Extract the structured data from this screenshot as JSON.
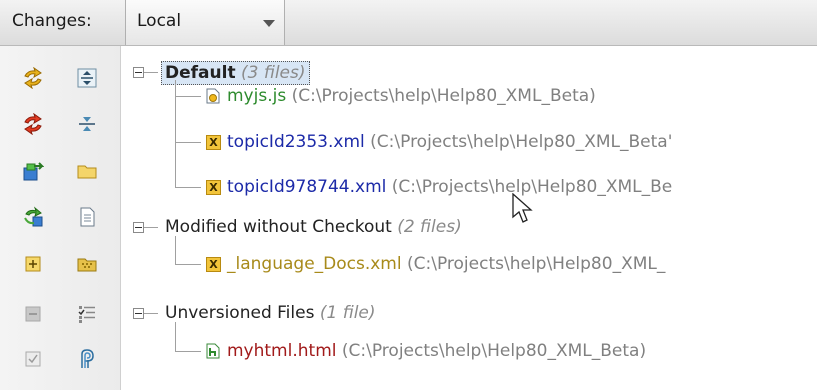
{
  "header": {
    "changes_label": "Changes:",
    "changelist_value": "Local"
  },
  "toolbar": {
    "icons": [
      "refresh-icon",
      "expand-all-icon",
      "rollback-icon",
      "collapse-all-icon",
      "move-to-changelist-icon",
      "folder-icon",
      "update-icon",
      "file-icon",
      "expand-icon",
      "package-icon",
      "disabled-icon",
      "diff-icon",
      "checkbox-icon",
      "history-icon"
    ]
  },
  "tree": {
    "groups": [
      {
        "name": "Default",
        "count": "(3 files)",
        "files": [
          {
            "name": "myjs.js",
            "path": "(C:\\Projects\\help\\Help80_XML_Beta)",
            "type": "js",
            "color": "#2e8b2e"
          },
          {
            "name": "topicId2353.xml",
            "path": "(C:\\Projects\\help\\Help80_XML_Beta'",
            "type": "xml",
            "color": "#1c2aa8"
          },
          {
            "name": "topicId978744.xml",
            "path": "(C:\\Projects\\help\\Help80_XML_Be",
            "type": "xml",
            "color": "#1c2aa8"
          }
        ]
      },
      {
        "name": "Modified without Checkout",
        "count": "(2 files)",
        "files": [
          {
            "name": "_language_Docs.xml",
            "path": "(C:\\Projects\\help\\Help80_XML_",
            "type": "xml",
            "color": "#a88a1a"
          }
        ]
      },
      {
        "name": "Unversioned Files",
        "count": "(1 file)",
        "files": [
          {
            "name": "myhtml.html",
            "path": "(C:\\Projects\\help\\Help80_XML_Beta)",
            "type": "html",
            "color": "#a11a1a"
          }
        ]
      }
    ]
  },
  "xml_icon_glyph": "X"
}
